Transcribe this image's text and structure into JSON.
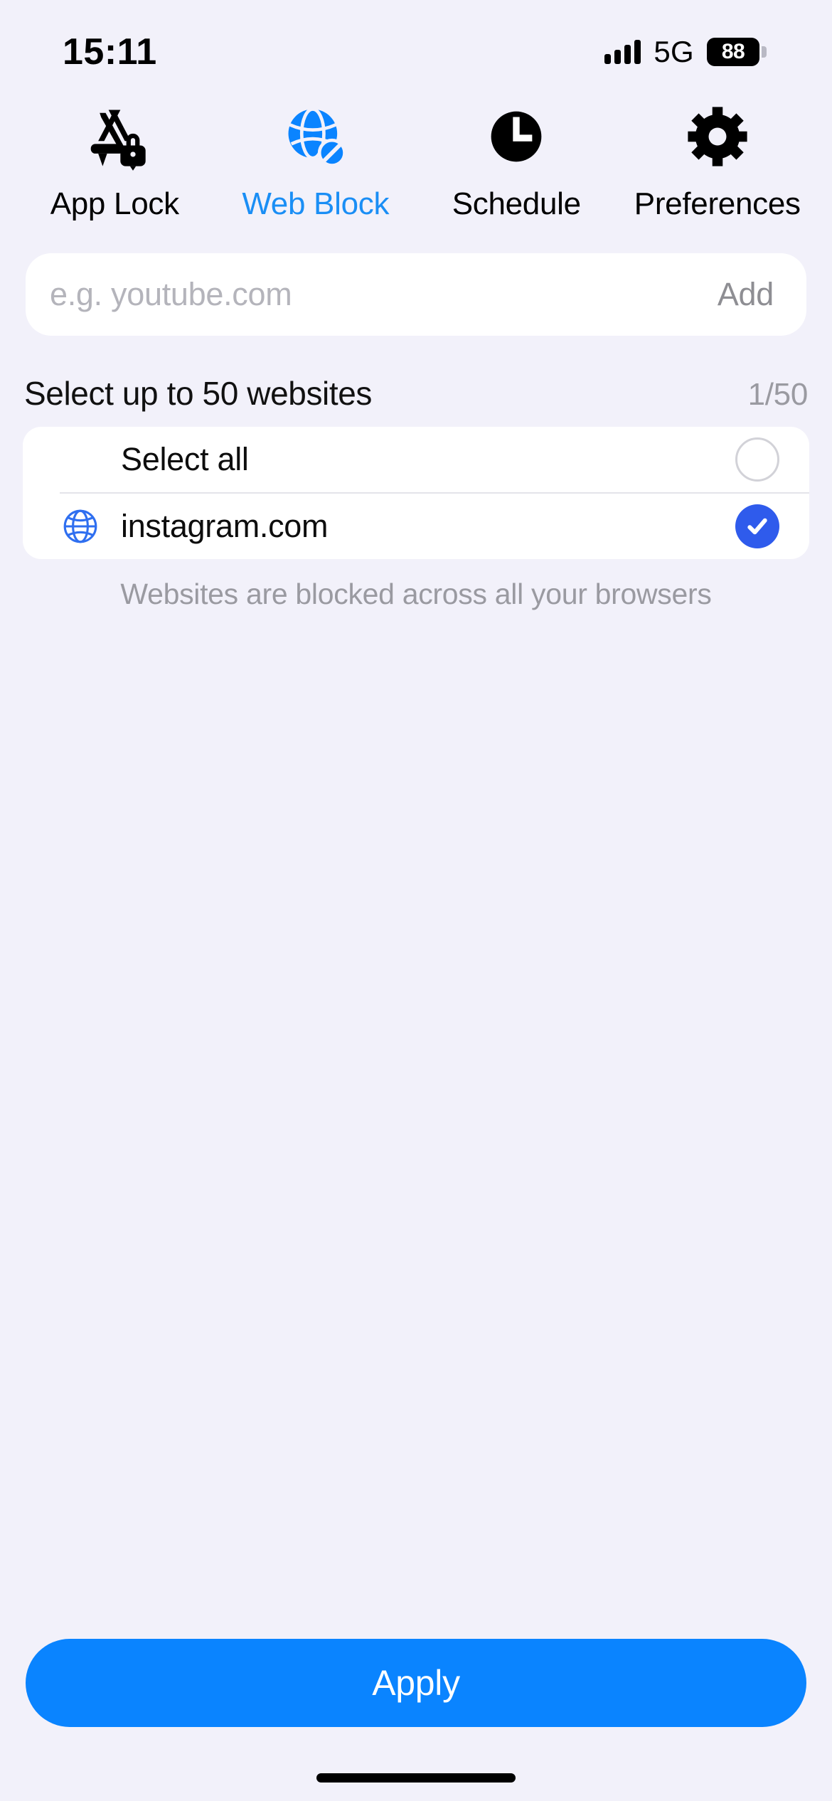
{
  "status_bar": {
    "time": "15:11",
    "network": "5G",
    "battery_level": "88",
    "signal_icon": "cellular-signal-icon",
    "battery_icon": "battery-icon"
  },
  "tabs": [
    {
      "label": "App Lock",
      "icon": "app-lock-icon",
      "active": false
    },
    {
      "label": "Web Block",
      "icon": "globe-blocked-icon",
      "active": true
    },
    {
      "label": "Schedule",
      "icon": "clock-icon",
      "active": false
    },
    {
      "label": "Preferences",
      "icon": "gear-icon",
      "active": false
    }
  ],
  "add_field": {
    "value": "",
    "placeholder": "e.g. youtube.com",
    "add_label": "Add"
  },
  "section": {
    "title": "Select up to 50 websites",
    "count": "1/50"
  },
  "list": {
    "select_all": {
      "label": "Select all",
      "checked": false
    },
    "items": [
      {
        "label": "instagram.com",
        "icon": "globe-icon",
        "checked": true
      }
    ]
  },
  "footnote": "Websites are blocked across all your browsers",
  "apply": {
    "label": "Apply"
  },
  "colors": {
    "background": "#f2f1fa",
    "accent_blue": "#0a84ff",
    "tab_active": "#1a8ef5",
    "check_blue": "#2f5bec",
    "muted_text": "#9a9aa1",
    "card_white": "#ffffff"
  }
}
